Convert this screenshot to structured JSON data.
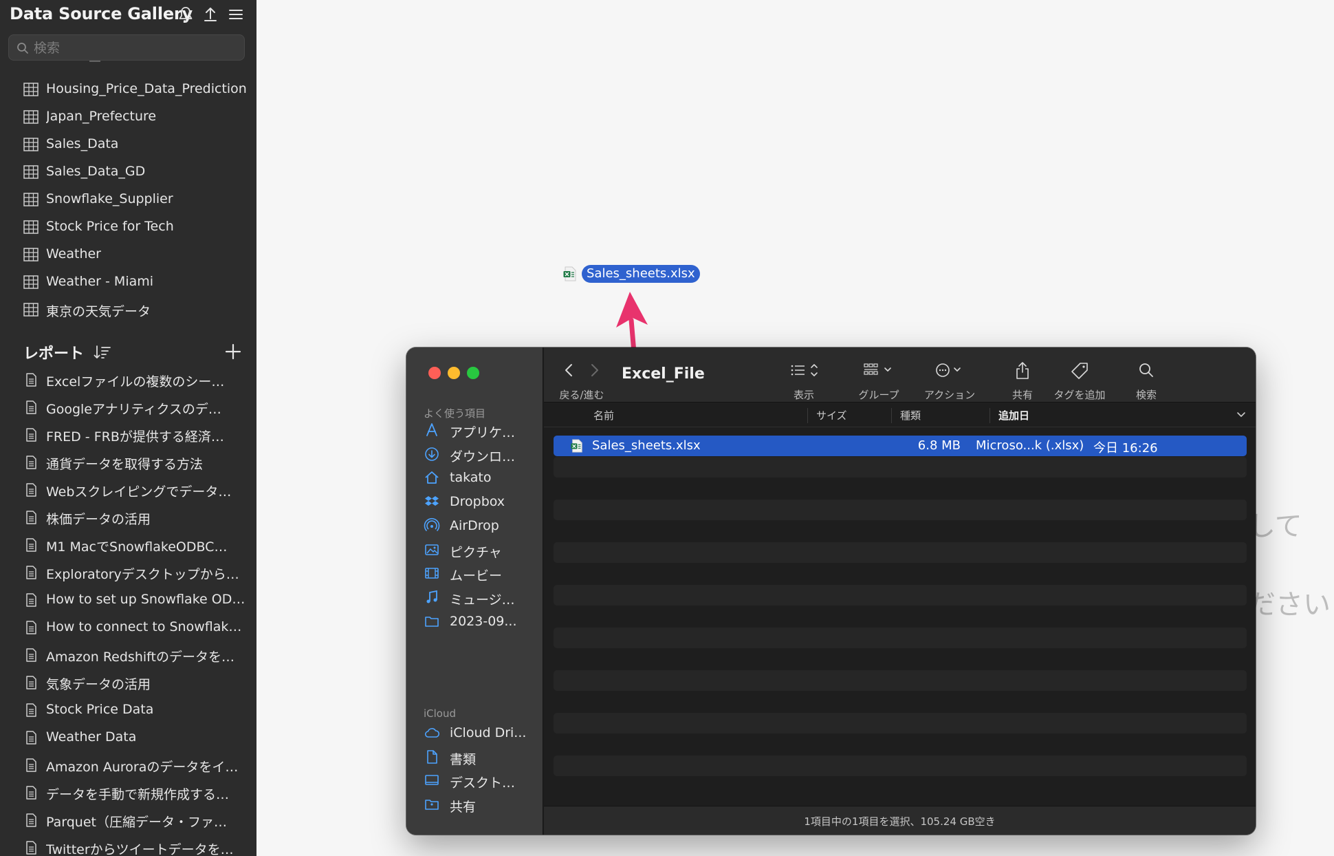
{
  "app": {
    "title": "Data Source Gallery",
    "search_placeholder": "検索"
  },
  "datasources": [
    {
      "label": "Housing_Price_Data_Prediction",
      "icon": "table-icon"
    },
    {
      "label": "Japan_Prefecture",
      "icon": "table-icon"
    },
    {
      "label": "Sales_Data",
      "icon": "table-icon"
    },
    {
      "label": "Sales_Data_GD",
      "icon": "table-icon"
    },
    {
      "label": "Snowflake_Supplier",
      "icon": "table-icon"
    },
    {
      "label": "Stock Price for Tech",
      "icon": "table-icon"
    },
    {
      "label": "Weather",
      "icon": "table-icon"
    },
    {
      "label": "Weather - Miami",
      "icon": "table-icon"
    },
    {
      "label": "東京の天気データ",
      "icon": "table-icon"
    }
  ],
  "reports": {
    "title": "レポート",
    "items": [
      "Excelファイルの複数のシー…",
      "Googleアナリティクスのデ…",
      "FRED - FRBが提供する経済…",
      "通貨データを取得する方法",
      "Webスクレイピングでデータ…",
      "株価データの活用",
      "M1 MacでSnowflakeODBC…",
      "Exploratoryデスクトップから…",
      "How to set up Snowflake OD…",
      "How to connect to Snowflak…",
      "Amazon Redshiftのデータを…",
      "気象データの活用",
      "Stock Price Data",
      "Weather Data",
      "Amazon Auroraのデータをイ…",
      "データを手動で新規作成する…",
      "Parquet（圧縮データ・ファ…",
      "Twitterからツイートデータを…"
    ]
  },
  "background_hint": {
    "line1": "して",
    "line2": "ださい"
  },
  "dragged_file": {
    "name": "Sales_sheets.xlsx"
  },
  "finder": {
    "folder_title": "Excel_File",
    "sidebar": {
      "favorites_label": "よく使う項目",
      "favorites": [
        {
          "label": "アプリケ…",
          "icon": "applications-icon"
        },
        {
          "label": "ダウンロ…",
          "icon": "downloads-icon"
        },
        {
          "label": "takato",
          "icon": "home-icon"
        },
        {
          "label": "Dropbox",
          "icon": "dropbox-icon"
        },
        {
          "label": "AirDrop",
          "icon": "airdrop-icon"
        },
        {
          "label": "ピクチャ",
          "icon": "pictures-icon"
        },
        {
          "label": "ムービー",
          "icon": "movies-icon"
        },
        {
          "label": "ミュージ…",
          "icon": "music-icon"
        },
        {
          "label": "2023-09...",
          "icon": "folder-icon"
        }
      ],
      "icloud_label": "iCloud",
      "icloud": [
        {
          "label": "iCloud Dri...",
          "icon": "icloud-icon"
        },
        {
          "label": "書類",
          "icon": "document-icon"
        },
        {
          "label": "デスクト…",
          "icon": "desktop-icon"
        },
        {
          "label": "共有",
          "icon": "shared-folder-icon"
        }
      ]
    },
    "toolbar": {
      "nav_caption": "戻る/進む",
      "view_caption": "表示",
      "group_caption": "グループ",
      "action_caption": "アクション",
      "share_caption": "共有",
      "tag_caption": "タグを追加",
      "search_caption": "検索"
    },
    "columns": {
      "name": "名前",
      "size": "サイズ",
      "kind": "種類",
      "date_added": "追加日"
    },
    "files": [
      {
        "name": "Sales_sheets.xlsx",
        "size": "6.8 MB",
        "kind": "Microso...k (.xlsx)",
        "date_added": "今日 16:26",
        "selected": true
      }
    ],
    "status": "1項目中の1項目を選択、105.24 GB空き"
  },
  "colors": {
    "sidebar_bg": "#2c2c2c",
    "selection": "#2559c4",
    "arrow": "#e8336d"
  }
}
